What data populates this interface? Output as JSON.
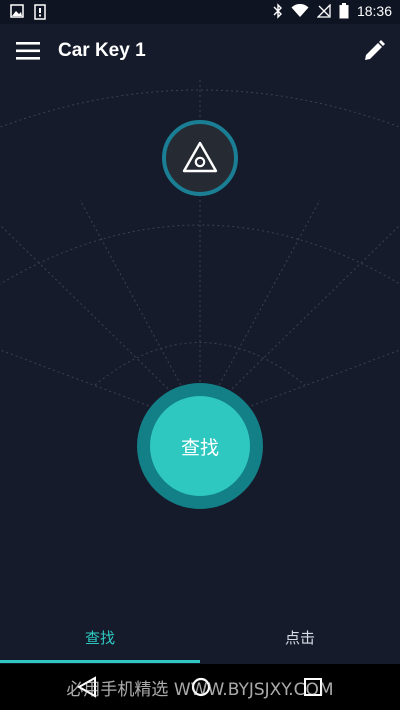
{
  "status_bar": {
    "time": "18:36",
    "left_icons": [
      "image-icon",
      "sim-icon"
    ],
    "right_icons": [
      "bluetooth-icon",
      "wifi-icon",
      "no-signal-icon",
      "battery-icon"
    ]
  },
  "toolbar": {
    "title": "Car Key 1",
    "menu_icon": "hamburger-menu-icon",
    "edit_icon": "pencil-icon"
  },
  "tracker": {
    "icon": "triangle-tag-icon"
  },
  "find_button": {
    "label": "查找"
  },
  "tabs": [
    {
      "label": "查找",
      "selected": true
    },
    {
      "label": "点击",
      "selected": false
    }
  ],
  "nav_bar": {
    "icons": [
      "back-icon",
      "home-icon",
      "recents-icon"
    ]
  },
  "watermark": {
    "text": "必用手机精选 WWW.BYJSJXY.COM"
  },
  "colors": {
    "background": "#151b2b",
    "accent": "#2ec8c1",
    "accent_dark": "#137f86",
    "tag_ring": "#1a7e95"
  }
}
